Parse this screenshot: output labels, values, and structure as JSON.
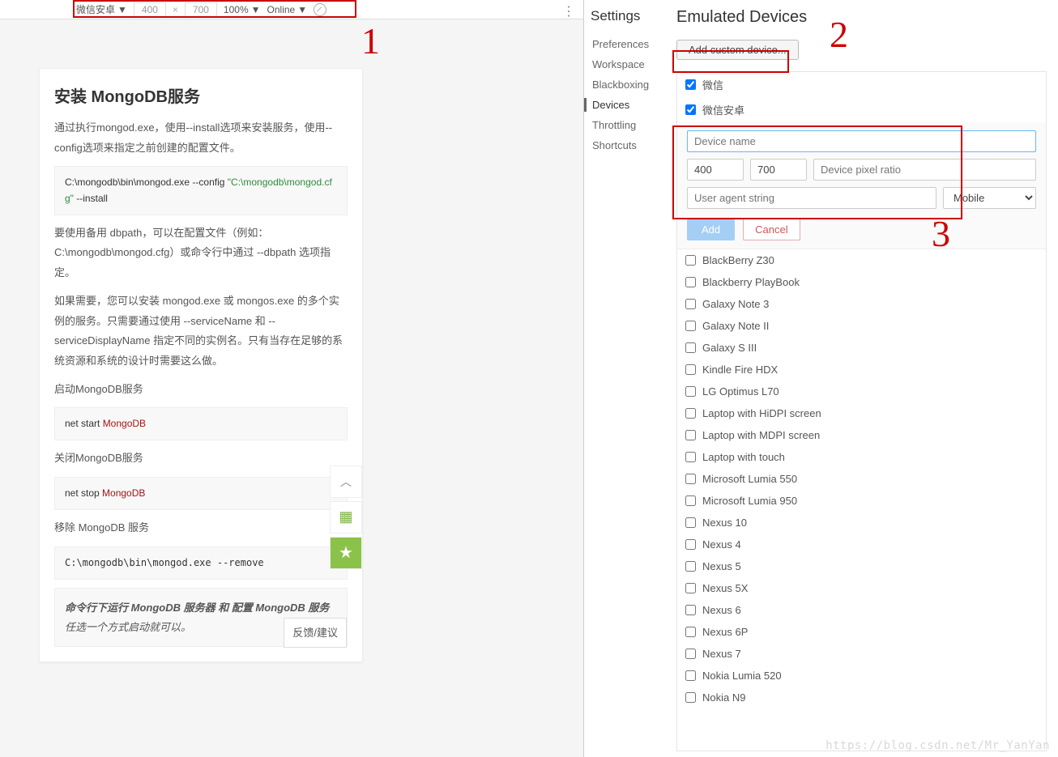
{
  "toolbar": {
    "device_name": "微信安卓",
    "width": "400",
    "height": "700",
    "zoom": "100%",
    "throttling": "Online"
  },
  "annotations": {
    "n1": "1",
    "n2": "2",
    "n3": "3"
  },
  "mobile": {
    "title": "安装 MongoDB服务",
    "p1": "通过执行mongod.exe，使用--install选项来安装服务，使用--config选项来指定之前创建的配置文件。",
    "code1a": "C:\\mongodb\\bin\\mongod.exe --config ",
    "code1b": "\"C:\\mongodb\\mongod.cfg\"",
    "code1c": " --install",
    "p2": "要使用备用 dbpath，可以在配置文件（例如：C:\\mongodb\\mongod.cfg）或命令行中通过 --dbpath 选项指定。",
    "p3": "如果需要，您可以安装 mongod.exe 或 mongos.exe 的多个实例的服务。只需要通过使用 --serviceName 和 --serviceDisplayName 指定不同的实例名。只有当存在足够的系统资源和系统的设计时需要这么做。",
    "p4": "启动MongoDB服务",
    "code2a": "net start ",
    "code2b": "MongoDB",
    "p5": "关闭MongoDB服务",
    "code3a": "net stop ",
    "code3b": "MongoDB",
    "p6": "移除 MongoDB 服务",
    "code4": "C:\\mongodb\\bin\\mongod.exe --remove",
    "note1": "命令行下运行 MongoDB 服务器 和 配置 MongoDB 服务",
    "note2": " 任选一个方式启动就可以。",
    "feedback": "反馈/建议"
  },
  "settings": {
    "title": "Settings",
    "nav": [
      "Preferences",
      "Workspace",
      "Blackboxing",
      "Devices",
      "Throttling",
      "Shortcuts"
    ],
    "active": "Devices",
    "heading": "Emulated Devices",
    "add_btn": "Add custom device...",
    "checked_devices": [
      "微信",
      "微信安卓"
    ],
    "form": {
      "name_ph": "Device name",
      "w": "400",
      "h": "700",
      "dpr_ph": "Device pixel ratio",
      "ua_ph": "User agent string",
      "mobile": "Mobile",
      "add": "Add",
      "cancel": "Cancel"
    },
    "devices": [
      "BlackBerry Z30",
      "Blackberry PlayBook",
      "Galaxy Note 3",
      "Galaxy Note II",
      "Galaxy S III",
      "Kindle Fire HDX",
      "LG Optimus L70",
      "Laptop with HiDPI screen",
      "Laptop with MDPI screen",
      "Laptop with touch",
      "Microsoft Lumia 550",
      "Microsoft Lumia 950",
      "Nexus 10",
      "Nexus 4",
      "Nexus 5",
      "Nexus 5X",
      "Nexus 6",
      "Nexus 6P",
      "Nexus 7",
      "Nokia Lumia 520",
      "Nokia N9"
    ]
  },
  "watermark": "https://blog.csdn.net/Mr_YanYan"
}
